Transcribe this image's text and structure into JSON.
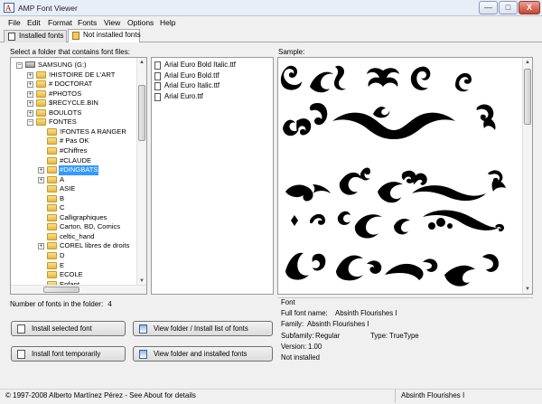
{
  "window": {
    "title": "AMP Font Viewer",
    "controls": {
      "minimize": "—",
      "maximize": "□",
      "close": "X"
    }
  },
  "menu": [
    "File",
    "Edit",
    "Format",
    "Fonts",
    "View",
    "Options",
    "Help"
  ],
  "tabs": [
    {
      "label": "Installed fonts",
      "active": false
    },
    {
      "label": "Not installed fonts",
      "active": true
    }
  ],
  "folder_pane": {
    "label": "Select a folder that contains font files:",
    "tree": [
      {
        "text": "SAMSUNG (G:)",
        "level": 0,
        "expander": "−",
        "icon": "drive"
      },
      {
        "text": "!HISTOIRE DE L'ART",
        "level": 1,
        "expander": "+",
        "icon": "folder"
      },
      {
        "text": "# DOCTORAT",
        "level": 1,
        "expander": "+",
        "icon": "folder"
      },
      {
        "text": "#PHOTOS",
        "level": 1,
        "expander": "+",
        "icon": "folder"
      },
      {
        "text": "$RECYCLE.BIN",
        "level": 1,
        "expander": "+",
        "icon": "folder"
      },
      {
        "text": "BOULOTS",
        "level": 1,
        "expander": "+",
        "icon": "folder"
      },
      {
        "text": "FONTES",
        "level": 1,
        "expander": "−",
        "icon": "folder"
      },
      {
        "text": "!FONTES A RANGER",
        "level": 2,
        "expander": "",
        "icon": "folder"
      },
      {
        "text": "# Pas OK",
        "level": 2,
        "expander": "",
        "icon": "folder"
      },
      {
        "text": "#Chiffres",
        "level": 2,
        "expander": "",
        "icon": "folder"
      },
      {
        "text": "#CLAUDE",
        "level": 2,
        "expander": "",
        "icon": "folder"
      },
      {
        "text": "#DINGBATS",
        "level": 2,
        "expander": "+",
        "icon": "folder",
        "selected": true
      },
      {
        "text": "A",
        "level": 2,
        "expander": "+",
        "icon": "folder"
      },
      {
        "text": "ASIE",
        "level": 2,
        "expander": "",
        "icon": "folder"
      },
      {
        "text": "B",
        "level": 2,
        "expander": "",
        "icon": "folder"
      },
      {
        "text": "C",
        "level": 2,
        "expander": "",
        "icon": "folder"
      },
      {
        "text": "Calligraphiques",
        "level": 2,
        "expander": "",
        "icon": "folder"
      },
      {
        "text": "Carton, BD, Comics",
        "level": 2,
        "expander": "",
        "icon": "folder"
      },
      {
        "text": "celtic_hand",
        "level": 2,
        "expander": "",
        "icon": "folder"
      },
      {
        "text": "COREL libres de droits",
        "level": 2,
        "expander": "+",
        "icon": "folder"
      },
      {
        "text": "D",
        "level": 2,
        "expander": "",
        "icon": "folder"
      },
      {
        "text": "E",
        "level": 2,
        "expander": "",
        "icon": "folder"
      },
      {
        "text": "ECOLE",
        "level": 2,
        "expander": "",
        "icon": "folder"
      },
      {
        "text": "Enfant",
        "level": 2,
        "expander": "",
        "icon": "folder"
      }
    ]
  },
  "file_list": [
    "Arial Euro Bold Italic.ttf",
    "Arial Euro Bold.ttf",
    "Arial Euro Italic.ttf",
    "Arial Euro.ttf"
  ],
  "sample": {
    "label": "Sample:"
  },
  "count": {
    "label": "Number of fonts in the folder:",
    "value": "4"
  },
  "buttons": {
    "install_selected": "Install selected font",
    "view_folder_install": "View folder / Install list of fonts",
    "install_temp": "Install font temporarily",
    "view_folder_installed": "View folder and installed fonts"
  },
  "font_info": {
    "heading": "Font",
    "full_name_label": "Full font name:",
    "full_name": "Absinth Flourishes I",
    "family_label": "Family:",
    "family": "Absinth Flourishes I",
    "subfamily_label": "Subfamily:",
    "subfamily": "Regular",
    "type_label": "Type:",
    "type": "TrueType",
    "version_label": "Version:",
    "version": "1.00",
    "status": "Not installed"
  },
  "status_bar": {
    "copyright": "© 1997-2008 Alberto Martínez Pérez  -  See About for details",
    "current_font": "Absinth Flourishes I"
  },
  "colors": {
    "selection": "#3399ff",
    "window_bg": "#f0f0f0",
    "titlebar": "#e8eef8"
  },
  "icons": {
    "app": "font-viewer-icon",
    "folder": "folder-icon",
    "drive": "drive-icon",
    "font_file": "font-file-icon"
  }
}
